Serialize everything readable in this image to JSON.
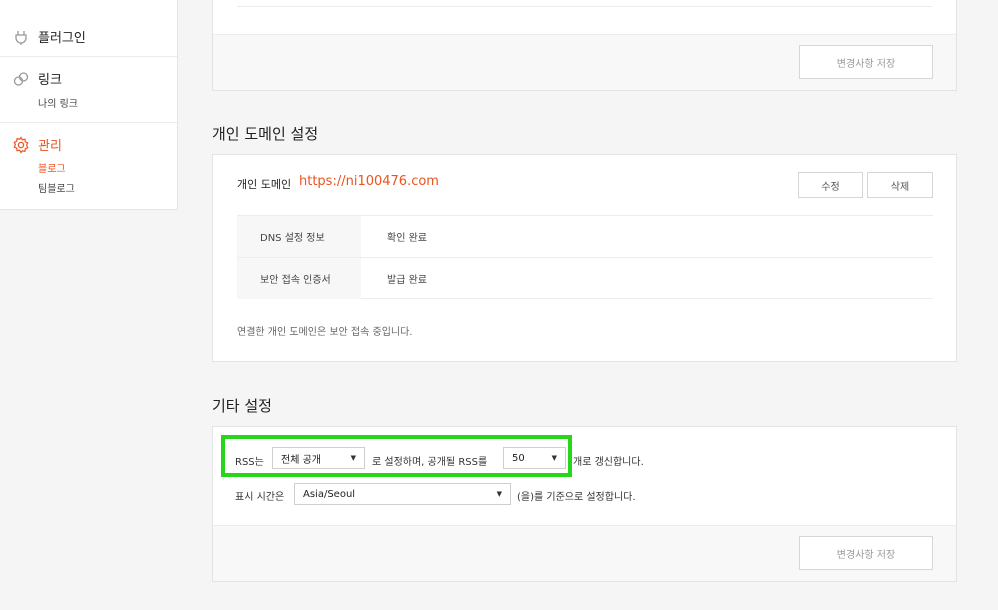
{
  "sidebar": {
    "plugin": {
      "label": "플러그인",
      "icon": "plug-icon"
    },
    "link": {
      "label": "링크",
      "icon": "link-icon",
      "sub": [
        "나의 링크"
      ]
    },
    "manage": {
      "label": "관리",
      "icon": "gear-icon",
      "sub": [
        "블로그",
        "팀블로그"
      ]
    }
  },
  "top_card": {
    "save_label": "변경사항 저장"
  },
  "domain_section": {
    "title": "개인 도메인 설정",
    "label": "개인 도메인",
    "url": "https://ni100476.com",
    "edit_label": "수정",
    "delete_label": "삭제",
    "rows": [
      {
        "key": "DNS 설정 정보",
        "value": "확인 완료"
      },
      {
        "key": "보안 접속 인증서",
        "value": "발급 완료"
      }
    ],
    "note": "연결한 개인 도메인은 보안 접속 중입니다."
  },
  "other_section": {
    "title": "기타 설정",
    "rss_prefix": "RSS는",
    "rss_visibility": "전체 공개",
    "rss_middle": "로 설정하며, 공개될 RSS를",
    "rss_count": "50",
    "rss_suffix": "개로 갱신합니다.",
    "tz_prefix": "표시 시간은",
    "tz_value": "Asia/Seoul",
    "tz_suffix": "(을)를 기준으로 설정합니다.",
    "save_label": "변경사항 저장"
  },
  "colors": {
    "accent": "#eb531f",
    "highlight": "#27d618"
  }
}
